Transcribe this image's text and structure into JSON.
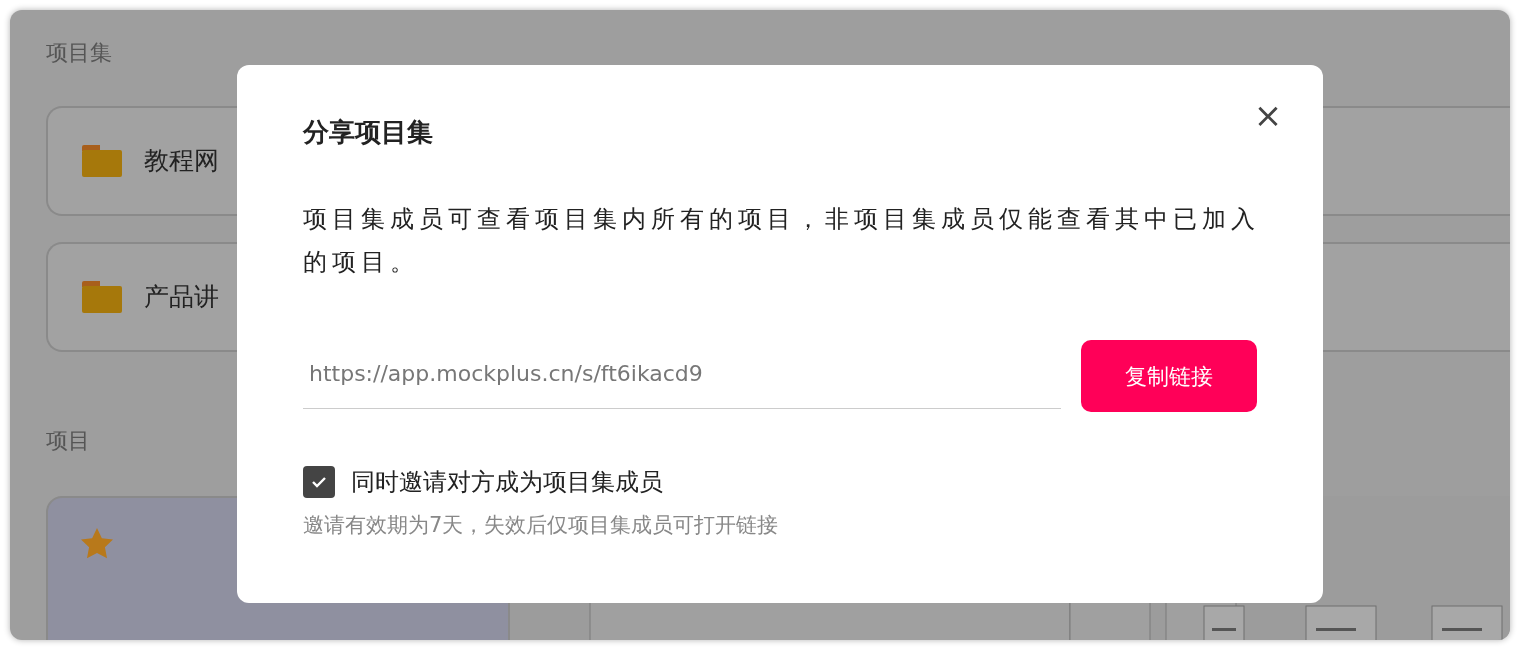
{
  "background": {
    "collections_heading": "项目集",
    "collections": [
      {
        "name": "教程网"
      },
      {
        "name": "产品讲"
      }
    ],
    "projects_heading": "项目",
    "projects": [
      {
        "starred": true,
        "kind": "card"
      },
      {
        "kind": "picture"
      }
    ]
  },
  "dialog": {
    "title": "分享项目集",
    "close": "×",
    "description": "项目集成员可查看项目集内所有的项目，非项目集成员仅能查看其中已加入的项目。",
    "link": {
      "value": "https://app.mockplus.cn/s/ft6ikacd9"
    },
    "copy_button": "复制链接",
    "invite": {
      "label": "同时邀请对方成为项目集成员",
      "checked": true
    },
    "hint": "邀请有效期为7天，失效后仅项目集成员可打开链接"
  }
}
